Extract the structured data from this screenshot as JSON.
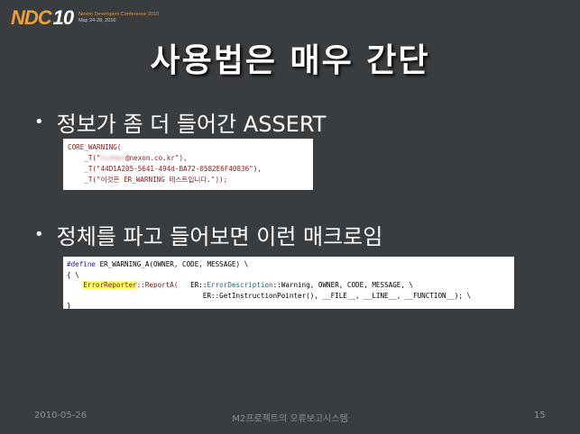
{
  "logo": {
    "mark_ndc": "NDC",
    "mark_num": "10",
    "sub_line1": "Nexon Developers Conference 2010",
    "sub_line2": "May 24-28, 2010"
  },
  "title": "사용법은 매우 간단",
  "bullet1": "정보가 좀 더 들어간 ASSERT",
  "bullet2": "정체를 파고 들어보면 이런 매크로임",
  "code1": {
    "line1": "CORE_WARNING(",
    "line2_pre": "    _T(\"",
    "line2_blur": "hidden",
    "line2_post": "@nexon.co.kr\"),",
    "line3": "    _T(\"44D1A205-5641-494d-BA72-0582E6F40836\"),",
    "line4": "    _T(\"이것은 ER_WARNING 테스트입니다.\"));"
  },
  "code2": {
    "line1_kw": "#define",
    "line1_rest": " ER_WARNING_A(OWNER, CODE, MESSAGE) \\",
    "line2": "{ \\",
    "line3_indent": "    ",
    "line3_hl": "ErrorReporter",
    "line3_rest": "::ReportA(",
    "line3_args_a": "   ER::",
    "line3_cls": "ErrorDescription",
    "line3_args_b": "::Warning, OWNER, CODE, MESSAGE, \\",
    "line4": "                                 ER::GetInstructionPointer(), __FILE__, __LINE__, __FUNCTION__); \\",
    "line5": "}"
  },
  "footer": {
    "date": "2010-05-26",
    "center": "M2프로젝트의 오류보고시스템",
    "page": "15"
  }
}
